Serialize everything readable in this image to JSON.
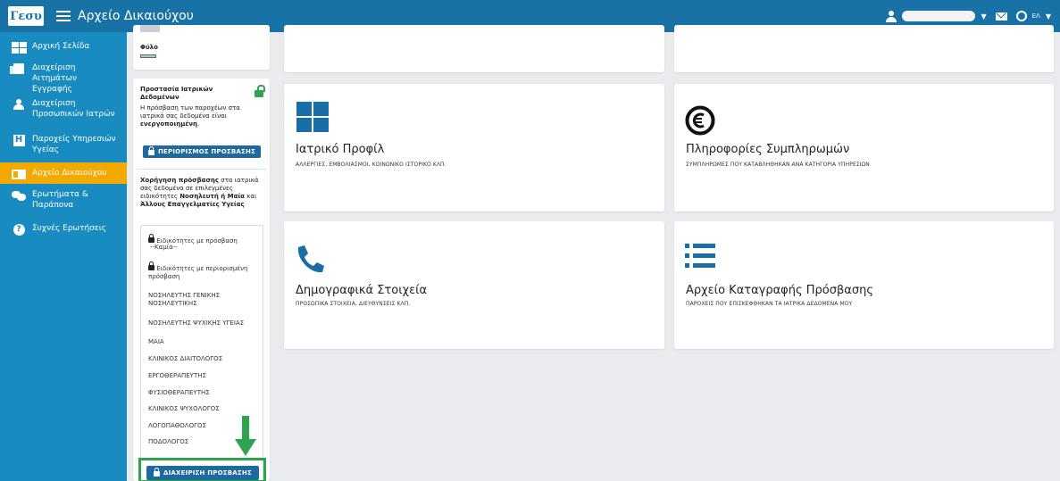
{
  "header": {
    "logo": "Γεσυ",
    "title": "Αρχείο Δικαιούχου",
    "language": "ΕΛ"
  },
  "sidebar": {
    "items": [
      {
        "label": "Αρχική Σελίδα",
        "icon": "grid-icon"
      },
      {
        "label": "Διαχείριση Αιτημάτων Εγγραφής",
        "icon": "documents-icon"
      },
      {
        "label": "Διαχείριση Προσωπικών Ιατρών",
        "icon": "doctor-icon"
      },
      {
        "label": "Παροχείς Υπηρεσιών Υγείας",
        "icon": "hospital-icon"
      },
      {
        "label": "Αρχείο Δικαιούχου",
        "icon": "id-card-icon",
        "active": true
      },
      {
        "label": "Ερωτήματα & Παράπονα",
        "icon": "chat-icon"
      },
      {
        "label": "Συχνές Ερωτήσεις",
        "icon": "question-icon"
      }
    ]
  },
  "left_panel": {
    "gender_label": "Φύλο",
    "protection_title": "Προστασία Ιατρικών Δεδομένων",
    "protection_text": "Η πρόσβαση των παροχέων στα ιατρικά σας δεδομένα είναι",
    "protection_status": "ενεργοποιημένη",
    "restrict_button": "ΠΕΡΙΟΡΙΣΜΟΣ ΠΡΟΣΒΑΣΗΣ",
    "grant_text_bold1": "Χορήγηση πρόσβασης",
    "grant_text1": " στα ιατρικά σας δεδομένα σε επιλεγμένες ειδικότητες ",
    "grant_text_bold2": "Νοσηλευτή ή Μαία",
    "grant_text2": " και ",
    "grant_text_bold3": "Άλλους Επαγγελματίες Υγείας",
    "access_heading": "Ειδικότητες με πρόσβαση",
    "access_none": "--Καμία--",
    "restricted_heading": "Ειδικότητες με περιορισμένη πρόσβαση",
    "specialties": [
      "ΝΟΣΗΛΕΥΤΗΣ ΓΕΝΙΚΗΣ ΝΟΣΗΛΕΥΤΙΚΗΣ",
      "ΝΟΣΗΛΕΥΤΗΣ ΨΥΧΙΚΗΣ ΥΓΕΙΑΣ",
      "ΜΑΙΑ",
      "ΚΛΙΝΙΚΟΣ ΔΙΑΙΤΟΛΟΓΟΣ",
      "ΕΡΓΟΘΕΡΑΠΕΥΤΗΣ",
      "ΦΥΣΙΟΘΕΡΑΠΕΥΤΗΣ",
      "ΚΛΙΝΙΚΟΣ ΨΥΧΟΛΟΓΟΣ",
      "ΛΟΓΟΠΑΘΟΛΟΓΟΣ",
      "ΠΟΔΟΛΟΓΟΣ"
    ],
    "manage_button": "ΔΙΑΧΕΙΡΙΣΗ ΠΡΟΣΒΑΣΗΣ"
  },
  "tiles": [
    {
      "title": "Ιατρικό Προφίλ",
      "subtitle": "ΑΛΛΕΡΓΙΕΣ, ΕΜΒΟΛΙΑΣΜΟΙ, ΚΟΙΝΩΝΙΚΟ ΙΣΤΟΡΙΚΟ ΚΛΠ.",
      "icon": "windows-grid-icon"
    },
    {
      "title": "Πληροφορίες Συμπληρωμών",
      "subtitle": "ΣΥΜΠΛΗΡΩΜΕΣ ΠΟΥ ΚΑΤΑΒΛΗΘΗΚΑΝ ΑΝΑ ΚΑΤΗΓΟΡΙΑ ΥΠΗΡΕΣΙΩΝ",
      "icon": "euro-icon"
    },
    {
      "title": "Δημογραφικά Στοιχεία",
      "subtitle": "ΠΡΟΣΩΠΙΚΑ ΣΤΟΙΧΕΙΑ, ΔΙΕΥΘΥΝΣΕΙΣ ΚΛΠ.",
      "icon": "phone-icon"
    },
    {
      "title": "Αρχείο Καταγραφής Πρόσβασης",
      "subtitle": "ΠΑΡΟΧΕΙΣ ΠΟΥ ΕΠΙΣΚΕΦΘΗΚΑΝ ΤΑ ΙΑΤΡΙΚΑ ΔΕΔΟΜΕΝΑ ΜΟΥ",
      "icon": "list-icon"
    }
  ],
  "colors": {
    "topbar": "#1872a6",
    "sidebar": "#188bc0",
    "active": "#f2a900",
    "accent": "#1e6aa0",
    "highlight": "#2ea44f"
  }
}
